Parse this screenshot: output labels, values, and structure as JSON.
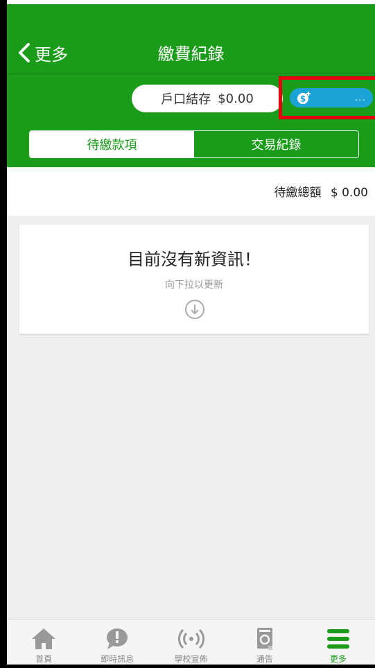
{
  "header": {
    "back_label": "更多",
    "title": "繳費紀錄"
  },
  "balance": {
    "label": "戶口結存",
    "amount": "$0.00"
  },
  "topup": {
    "icon": "coin-plus-icon",
    "dots": "..."
  },
  "tabs": [
    {
      "label": "待繳款項",
      "active": true
    },
    {
      "label": "交易紀錄",
      "active": false
    }
  ],
  "total": {
    "label": "待繳總額",
    "amount": "$ 0.00"
  },
  "empty": {
    "title": "目前沒有新資訊！",
    "hint": "向下拉以更新",
    "icon": "arrow-down-circle-icon"
  },
  "nav": [
    {
      "label": "首頁",
      "icon": "home-icon"
    },
    {
      "label": "即時訊息",
      "icon": "message-alert-icon"
    },
    {
      "label": "學校宣佈",
      "icon": "broadcast-icon"
    },
    {
      "label": "通告",
      "icon": "notice-icon"
    },
    {
      "label": "更多",
      "icon": "menu-icon",
      "active": true
    }
  ],
  "colors": {
    "primary_green": "#1a9c1a",
    "topup_blue": "#1aa3d4",
    "highlight_red": "#e3000f"
  }
}
